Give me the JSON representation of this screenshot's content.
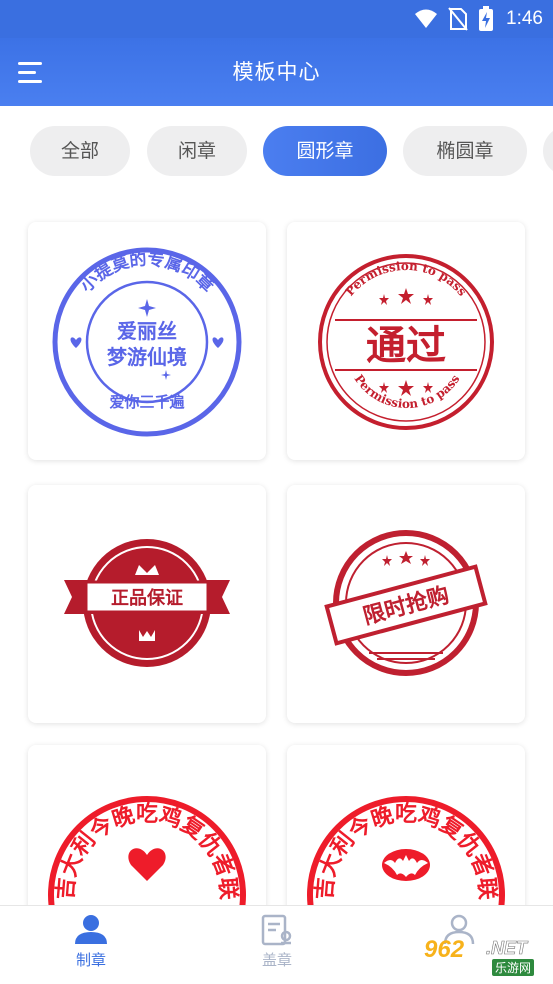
{
  "status_bar": {
    "time": "1:46",
    "icons": [
      "wifi-icon",
      "no-sim-icon",
      "battery-charging-icon"
    ]
  },
  "header": {
    "title": "模板中心",
    "menu_icon": "hamburger-menu-icon"
  },
  "tabs": [
    {
      "label": "全部",
      "active": false
    },
    {
      "label": "闲章",
      "active": false
    },
    {
      "label": "圆形章",
      "active": true
    },
    {
      "label": "椭圆章",
      "active": false
    }
  ],
  "templates": [
    {
      "id": "seal-1",
      "color": "#5a66e8",
      "arc_text": "小提莫的专属印章",
      "center_lines": [
        "爱丽丝",
        "梦游仙境"
      ],
      "bottom_text": "爱你三千遍"
    },
    {
      "id": "seal-2",
      "color": "#c41f2e",
      "arc_text_top": "Permission to pass",
      "arc_text_bottom": "Permission to pass",
      "center_text": "通过"
    },
    {
      "id": "seal-3",
      "color": "#b51c2c",
      "ribbon_text": "正品保证"
    },
    {
      "id": "seal-4",
      "color": "#bf2030",
      "banner_text": "限时抢购"
    },
    {
      "id": "seal-5",
      "color": "#ee1c2a",
      "arc_text": "大吉大利今晚吃鸡复仇者联盟",
      "center_icon": "heart-icon"
    },
    {
      "id": "seal-6",
      "color": "#ee1c2a",
      "arc_text": "大吉大利今晚吃鸡复仇者联盟",
      "center_icon": "bat-icon"
    }
  ],
  "bottom_nav": [
    {
      "label": "制章",
      "icon": "person-icon",
      "active": true,
      "color": "#3a6fe0"
    },
    {
      "label": "盖章",
      "icon": "stamp-document-icon",
      "active": false,
      "color": "#aab4c8"
    },
    {
      "label": "",
      "icon": "profile-icon",
      "active": false,
      "color": "#aab4c8"
    }
  ],
  "watermark": {
    "number": "962",
    "suffix": ".NET",
    "subtitle": "乐游网"
  }
}
